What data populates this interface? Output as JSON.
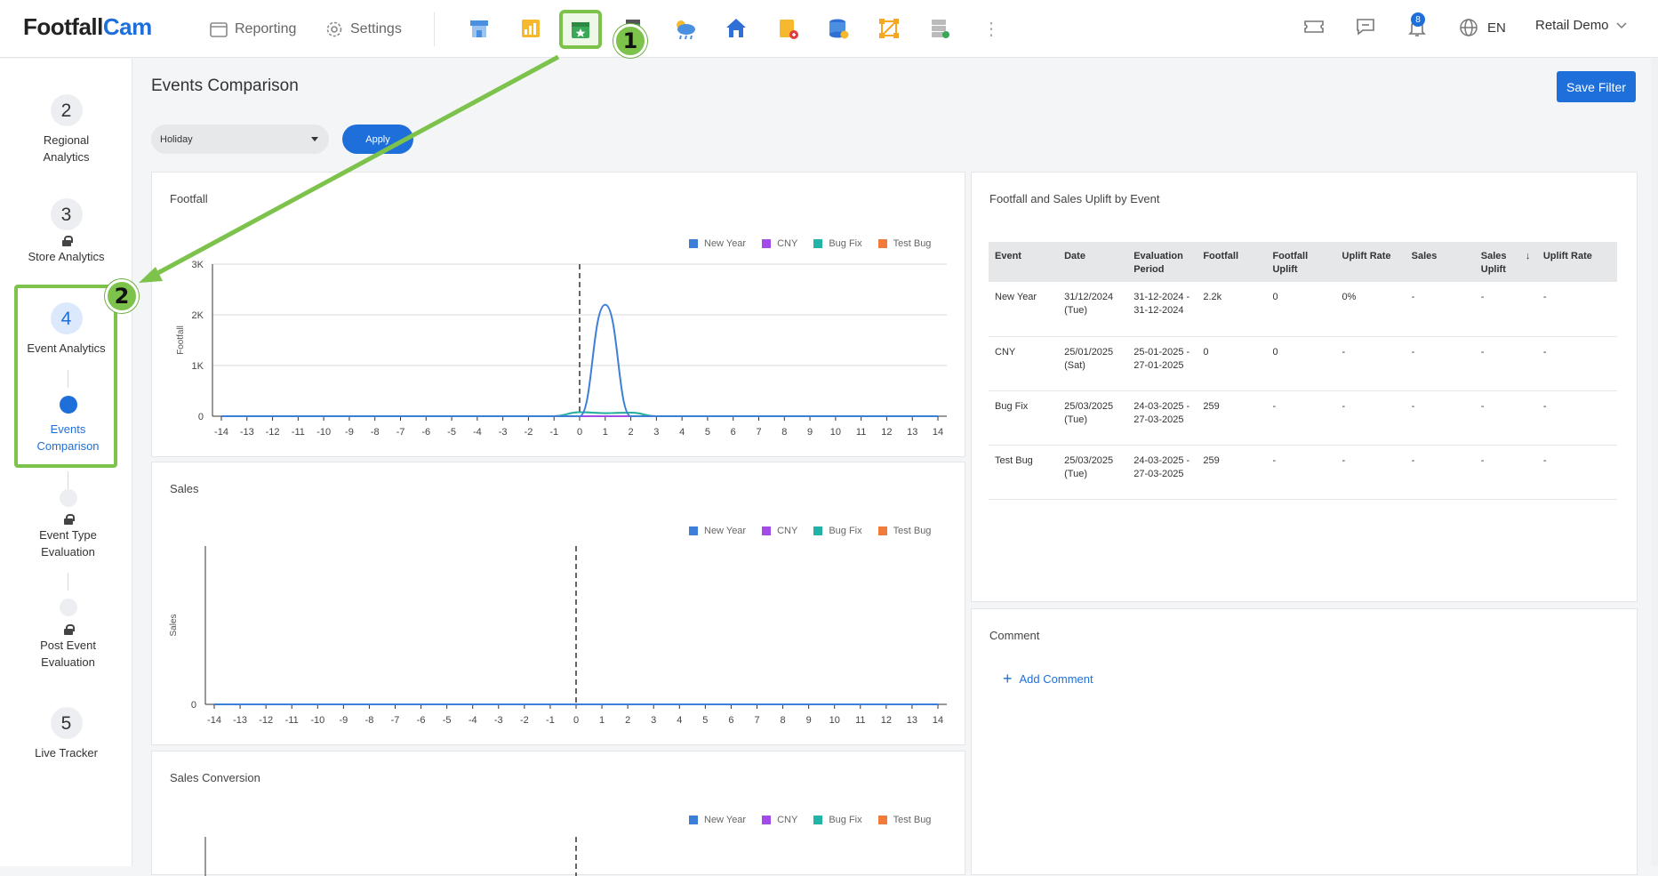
{
  "brand": {
    "name_part1": "Footfall",
    "name_part2": "Cam",
    "accent": "#1e6fd9",
    "highlight": "#7cc24b"
  },
  "topnav": {
    "reporting": "Reporting",
    "settings": "Settings",
    "modules": [
      "store-icon",
      "chart-icon",
      "calendar-event-icon",
      "building-icon",
      "weather-icon",
      "home-icon",
      "tag-icon",
      "database-icon",
      "nodes-icon",
      "server-icon"
    ],
    "more": "⋮",
    "language": "EN",
    "account": "Retail Demo",
    "notifications": "8"
  },
  "callouts": {
    "one": "1",
    "two": "2"
  },
  "sidebar": {
    "steps": [
      {
        "num": "2",
        "label": "Regional Analytics"
      },
      {
        "num": "3",
        "label": "Store Analytics"
      },
      {
        "num": "4",
        "label": "Event Analytics"
      },
      {
        "label": "Events Comparison"
      },
      {
        "label": "Event Type Evaluation"
      },
      {
        "label": "Post Event Evaluation"
      },
      {
        "num": "5",
        "label": "Live Tracker"
      }
    ]
  },
  "page": {
    "title": "Events Comparison",
    "save_filter": "Save Filter",
    "filter_value": "Holiday",
    "apply": "Apply"
  },
  "legend": [
    {
      "name": "New Year",
      "color": "#3d7fd8"
    },
    {
      "name": "CNY",
      "color": "#a24be8"
    },
    {
      "name": "Bug Fix",
      "color": "#21b3a8"
    },
    {
      "name": "Test Bug",
      "color": "#f07b3a"
    }
  ],
  "chart_data": [
    {
      "type": "line",
      "title": "Footfall",
      "ylabel": "Footfall",
      "x": [
        -14,
        -13,
        -12,
        -11,
        -10,
        -9,
        -8,
        -7,
        -6,
        -5,
        -4,
        -3,
        -2,
        -1,
        0,
        1,
        2,
        3,
        4,
        5,
        6,
        7,
        8,
        9,
        10,
        11,
        12,
        13,
        14
      ],
      "ylim": [
        0,
        3000
      ],
      "yticks": [
        "0",
        "1K",
        "2K",
        "3K"
      ],
      "series": [
        {
          "name": "New Year",
          "values": [
            0,
            0,
            0,
            0,
            0,
            0,
            0,
            0,
            0,
            0,
            0,
            0,
            0,
            0,
            0,
            2200,
            0,
            0,
            0,
            0,
            0,
            0,
            0,
            0,
            0,
            0,
            0,
            0,
            0
          ]
        },
        {
          "name": "CNY",
          "values": [
            0,
            0,
            0,
            0,
            0,
            0,
            0,
            0,
            0,
            0,
            0,
            0,
            0,
            0,
            0,
            0,
            0,
            0,
            0,
            0,
            0,
            0,
            0,
            0,
            0,
            0,
            0,
            0,
            0
          ]
        },
        {
          "name": "Bug Fix",
          "values": [
            0,
            0,
            0,
            0,
            0,
            0,
            0,
            0,
            0,
            0,
            0,
            0,
            0,
            0,
            80,
            60,
            70,
            0,
            0,
            0,
            0,
            0,
            0,
            0,
            0,
            0,
            0,
            0,
            0
          ]
        },
        {
          "name": "Test Bug",
          "values": [
            0,
            0,
            0,
            0,
            0,
            0,
            0,
            0,
            0,
            0,
            0,
            0,
            0,
            0,
            80,
            60,
            70,
            0,
            0,
            0,
            0,
            0,
            0,
            0,
            0,
            0,
            0,
            0,
            0
          ]
        }
      ],
      "vline_at": 0
    },
    {
      "type": "line",
      "title": "Sales",
      "ylabel": "Sales",
      "x": [
        -14,
        -13,
        -12,
        -11,
        -10,
        -9,
        -8,
        -7,
        -6,
        -5,
        -4,
        -3,
        -2,
        -1,
        0,
        1,
        2,
        3,
        4,
        5,
        6,
        7,
        8,
        9,
        10,
        11,
        12,
        13,
        14
      ],
      "ylim": [
        0,
        1
      ],
      "yticks": [
        "0"
      ],
      "series": [
        {
          "name": "New Year",
          "values": [
            0,
            0,
            0,
            0,
            0,
            0,
            0,
            0,
            0,
            0,
            0,
            0,
            0,
            0,
            0,
            0,
            0,
            0,
            0,
            0,
            0,
            0,
            0,
            0,
            0,
            0,
            0,
            0,
            0
          ]
        },
        {
          "name": "CNY",
          "values": [
            0,
            0,
            0,
            0,
            0,
            0,
            0,
            0,
            0,
            0,
            0,
            0,
            0,
            0,
            0,
            0,
            0,
            0,
            0,
            0,
            0,
            0,
            0,
            0,
            0,
            0,
            0,
            0,
            0
          ]
        },
        {
          "name": "Bug Fix",
          "values": [
            0,
            0,
            0,
            0,
            0,
            0,
            0,
            0,
            0,
            0,
            0,
            0,
            0,
            0,
            0,
            0,
            0,
            0,
            0,
            0,
            0,
            0,
            0,
            0,
            0,
            0,
            0,
            0,
            0
          ]
        },
        {
          "name": "Test Bug",
          "values": [
            0,
            0,
            0,
            0,
            0,
            0,
            0,
            0,
            0,
            0,
            0,
            0,
            0,
            0,
            0,
            0,
            0,
            0,
            0,
            0,
            0,
            0,
            0,
            0,
            0,
            0,
            0,
            0,
            0
          ]
        }
      ],
      "vline_at": 0
    },
    {
      "type": "line",
      "title": "Sales Conversion",
      "series": [
        {
          "name": "New Year",
          "values": []
        },
        {
          "name": "CNY",
          "values": []
        },
        {
          "name": "Bug Fix",
          "values": []
        },
        {
          "name": "Test Bug",
          "values": []
        }
      ],
      "vline_at": 0
    }
  ],
  "uplift": {
    "title": "Footfall and Sales Uplift by Event",
    "columns": [
      "Event",
      "Date",
      "Evaluation Period",
      "Footfall",
      "Footfall Uplift",
      "Uplift Rate",
      "Sales",
      "Sales Uplift",
      "↓",
      "Uplift Rate"
    ],
    "rows": [
      [
        "New Year",
        "31/12/2024 (Tue)",
        "31-12-2024 - 31-12-2024",
        "2.2k",
        "0",
        "0%",
        "-",
        "-",
        "",
        "-"
      ],
      [
        "CNY",
        "25/01/2025 (Sat)",
        "25-01-2025 - 27-01-2025",
        "0",
        "0",
        "-",
        "-",
        "-",
        "",
        "-"
      ],
      [
        "Bug Fix",
        "25/03/2025 (Tue)",
        "24-03-2025 - 27-03-2025",
        "259",
        "-",
        "-",
        "-",
        "-",
        "",
        "-"
      ],
      [
        "Test Bug",
        "25/03/2025 (Tue)",
        "24-03-2025 - 27-03-2025",
        "259",
        "-",
        "-",
        "-",
        "-",
        "",
        "-"
      ]
    ]
  },
  "comment": {
    "title": "Comment",
    "add": "Add Comment"
  }
}
